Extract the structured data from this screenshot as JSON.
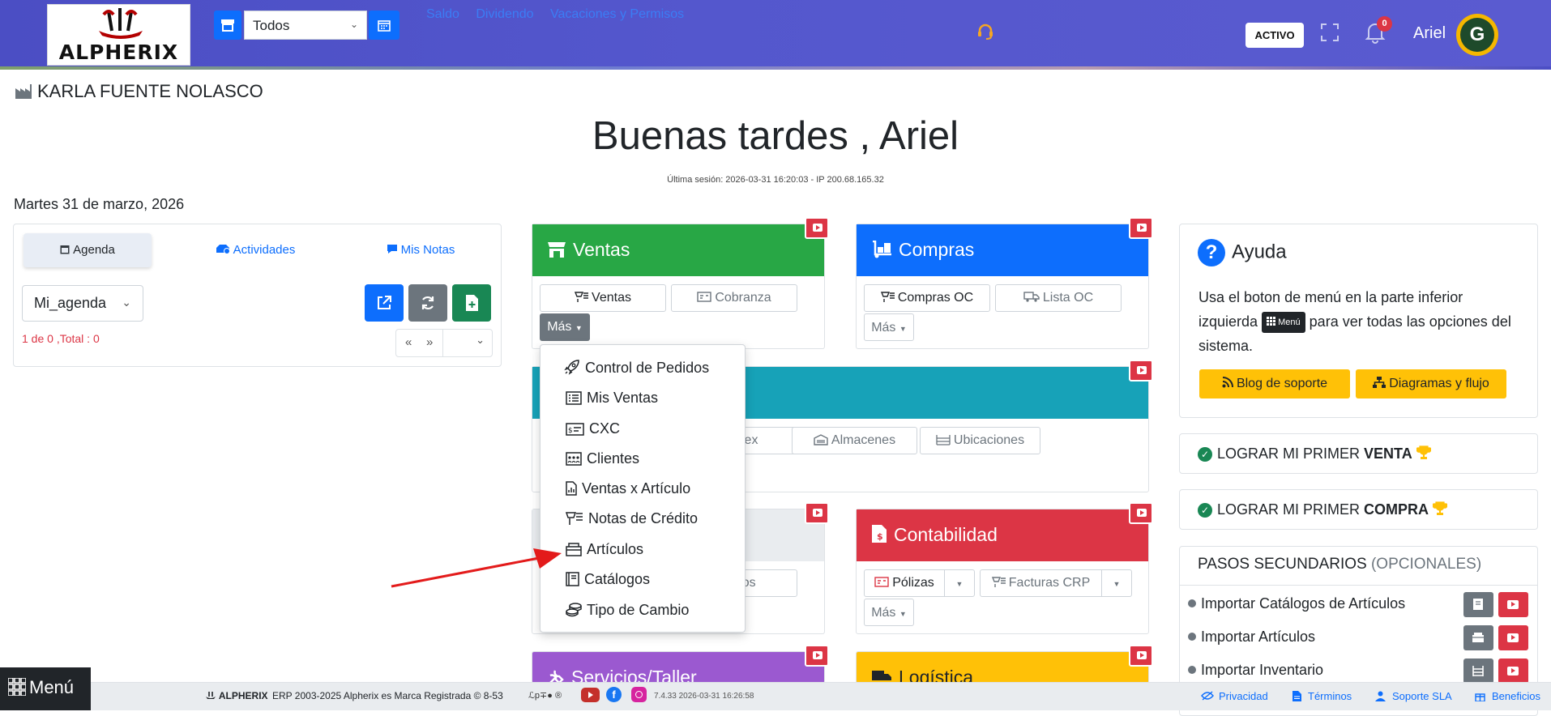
{
  "header": {
    "logo_text": "ALPHERIX",
    "branch_select": "Todos",
    "nav_links": [
      "Saldo",
      "Dividendo",
      "Vacaciones y Permisos"
    ],
    "status_label": "ACTIVO",
    "notifications_count": "0",
    "user_name": "Ariel"
  },
  "company_name": "KARLA FUENTE NOLASCO",
  "greeting": "Buenas tardes , Ariel",
  "last_session": "Última sesión: 2026-03-31 16:20:03 - IP 200.68.165.32",
  "date": "Martes 31 de marzo, 2026",
  "agenda": {
    "tabs": [
      "Agenda",
      "Actividades",
      "Mis Notas"
    ],
    "active_tab": "Agenda",
    "agenda_select": "Mi_agenda",
    "count_text": "1 de 0 ,Total : 0",
    "pager_prev": "«",
    "pager_next": "»"
  },
  "modules": {
    "ventas": {
      "title": "Ventas",
      "buttons": [
        "Ventas",
        "Cobranza"
      ],
      "more": "Más"
    },
    "compras": {
      "title": "Compras",
      "buttons": [
        "Compras OC",
        "Lista OC"
      ],
      "more": "Más"
    },
    "inventario": {
      "buttons": [
        "ex",
        "Almacenes",
        "Ubicaciones"
      ]
    },
    "productos": {
      "buttons": [
        "Precios"
      ]
    },
    "contabilidad": {
      "title": "Contabilidad",
      "buttons": [
        "Pólizas",
        "Facturas CRP"
      ],
      "more": "Más"
    },
    "servicios": {
      "title": "Servicios/Taller"
    },
    "logistica": {
      "title": "Logística"
    }
  },
  "ventas_dropdown": [
    "Control de Pedidos",
    "Mis Ventas",
    "CXC",
    "Clientes",
    "Ventas x Artículo",
    "Notas de Crédito",
    "Artículos",
    "Catálogos",
    "Tipo de Cambio"
  ],
  "help": {
    "title": "Ayuda",
    "text_before": "Usa el boton de menú en la parte inferior izquierda",
    "menu_chip": "Menú",
    "text_after": "para ver todas las opciones del sistema.",
    "blog_button": "Blog de soporte",
    "diagrams_button": "Diagramas y flujo"
  },
  "steps": {
    "first_sale_prefix": "LOGRAR MI PRIMER",
    "first_sale_bold": "VENTA",
    "first_purchase_prefix": "LOGRAR MI PRIMER",
    "first_purchase_bold": "COMPRA"
  },
  "secondary": {
    "title": "PASOS SECUNDARIOS",
    "title_suffix": "(OPCIONALES)",
    "items": [
      "Importar Catálogos de Artículos",
      "Importar Artículos",
      "Importar Inventario"
    ]
  },
  "footer": {
    "menu_label": "Menú",
    "brand": "ALPHERIX",
    "copyright": "ERP 2003-2025 Alpherix es Marca Registrada © 8-53",
    "version": "7.4.33 2026-03-31 16:26:58",
    "links": [
      "Privacidad",
      "Términos",
      "Soporte SLA",
      "Beneficios"
    ]
  },
  "colors": {
    "header": "#4b4ec4",
    "ventas": "#28a745",
    "compras": "#0d6efd",
    "inventario": "#17a2b8",
    "contabilidad": "#dc3545",
    "servicios": "#9b59d0",
    "logistica": "#ffc107",
    "help_buttons": "#ffc107"
  }
}
